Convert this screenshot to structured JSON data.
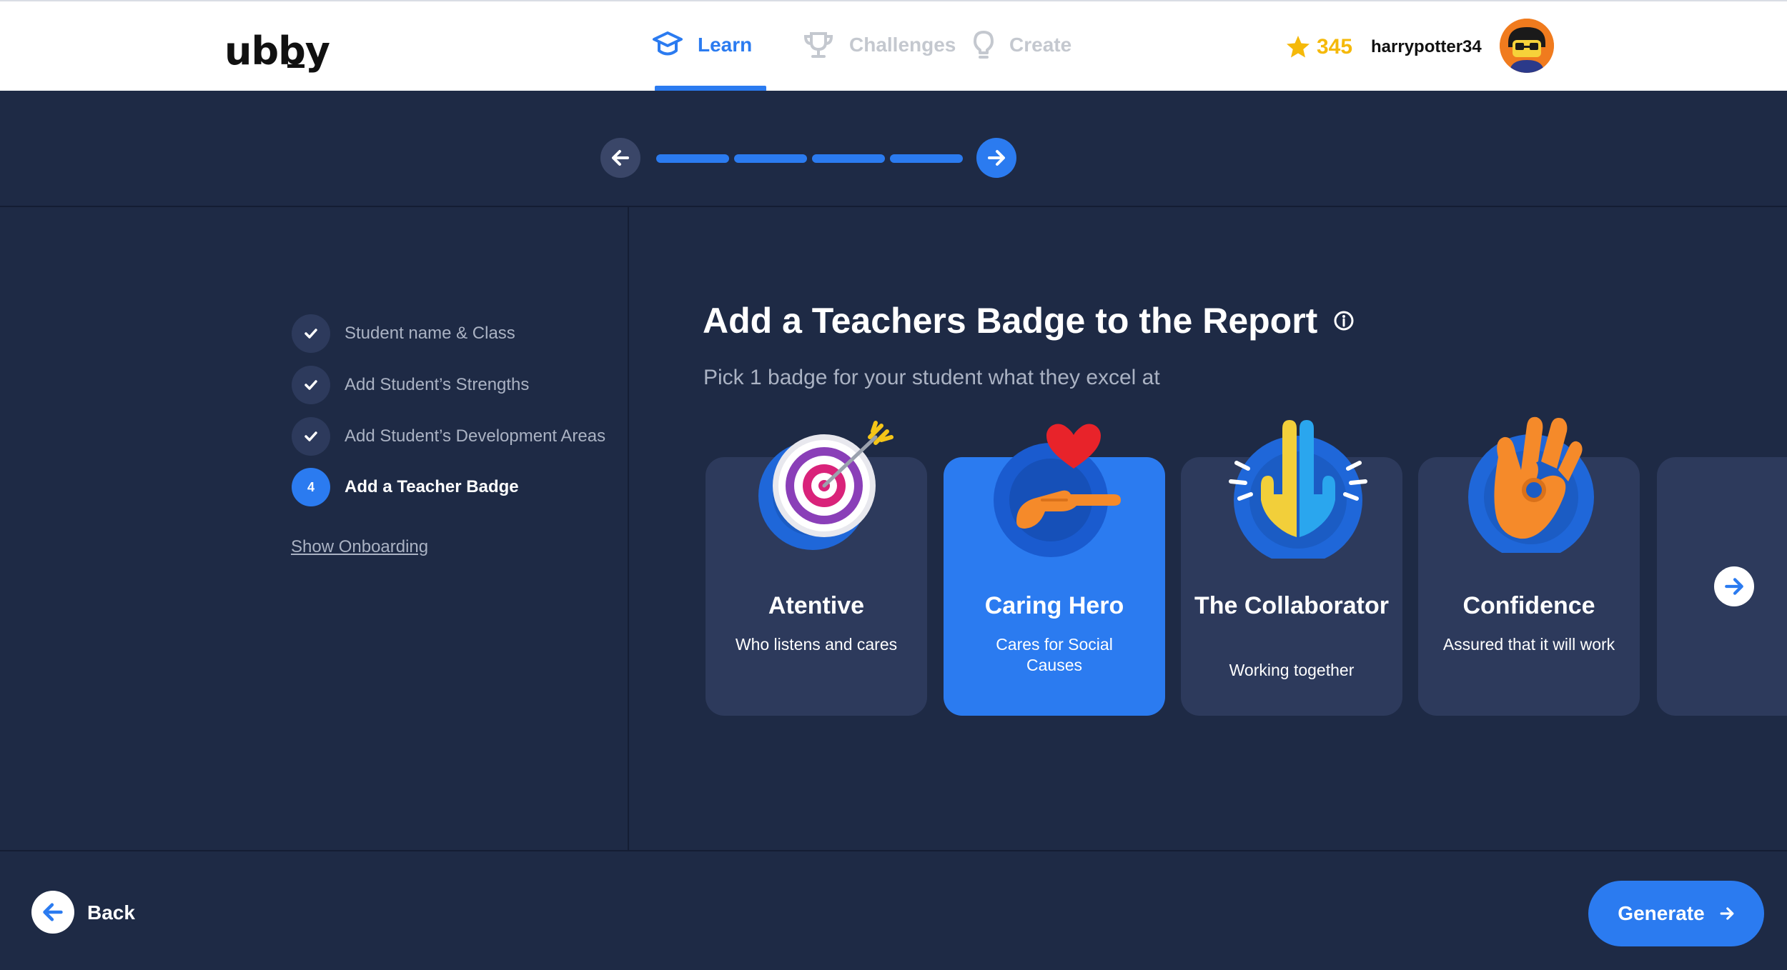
{
  "header": {
    "logo": "ubby",
    "nav": [
      {
        "label": "Learn",
        "icon": "graduation-cap-icon",
        "active": true
      },
      {
        "label": "Challenges",
        "icon": "trophy-icon",
        "active": false
      },
      {
        "label": "Create",
        "icon": "lightbulb-icon",
        "active": false
      }
    ],
    "points": "345",
    "username": "harrypotter34"
  },
  "progress": {
    "total_steps": 4,
    "completed_steps": 4
  },
  "steps": [
    {
      "number": "",
      "label": "Student name & Class",
      "status": "done"
    },
    {
      "number": "",
      "label": "Add Student’s Strengths",
      "status": "done"
    },
    {
      "number": "",
      "label": "Add Student’s Development Areas",
      "status": "done"
    },
    {
      "number": "4",
      "label": "Add a Teacher Badge",
      "status": "current"
    }
  ],
  "onboarding_link": "Show Onboarding",
  "main": {
    "title": "Add a Teachers Badge to the Report",
    "subtitle": "Pick 1 badge for your student what they excel at"
  },
  "badges": [
    {
      "title": "Atentive",
      "description": "Who listens and cares",
      "icon": "target-icon",
      "selected": false
    },
    {
      "title": "Caring Hero",
      "description": "Cares for Social Causes",
      "icon": "heart-hand-icon",
      "selected": true
    },
    {
      "title": "The Collaborator",
      "description": "Working together",
      "icon": "two-hands-icon",
      "selected": false
    },
    {
      "title": "Confidence",
      "description": "Assured that it will work",
      "icon": "ok-hand-icon",
      "selected": false
    }
  ],
  "footer": {
    "back_label": "Back",
    "generate_label": "Generate"
  },
  "colors": {
    "accent": "#2b7bf0",
    "background": "#1e2a45",
    "card": "#2d3a5c",
    "points": "#f5b90a"
  }
}
